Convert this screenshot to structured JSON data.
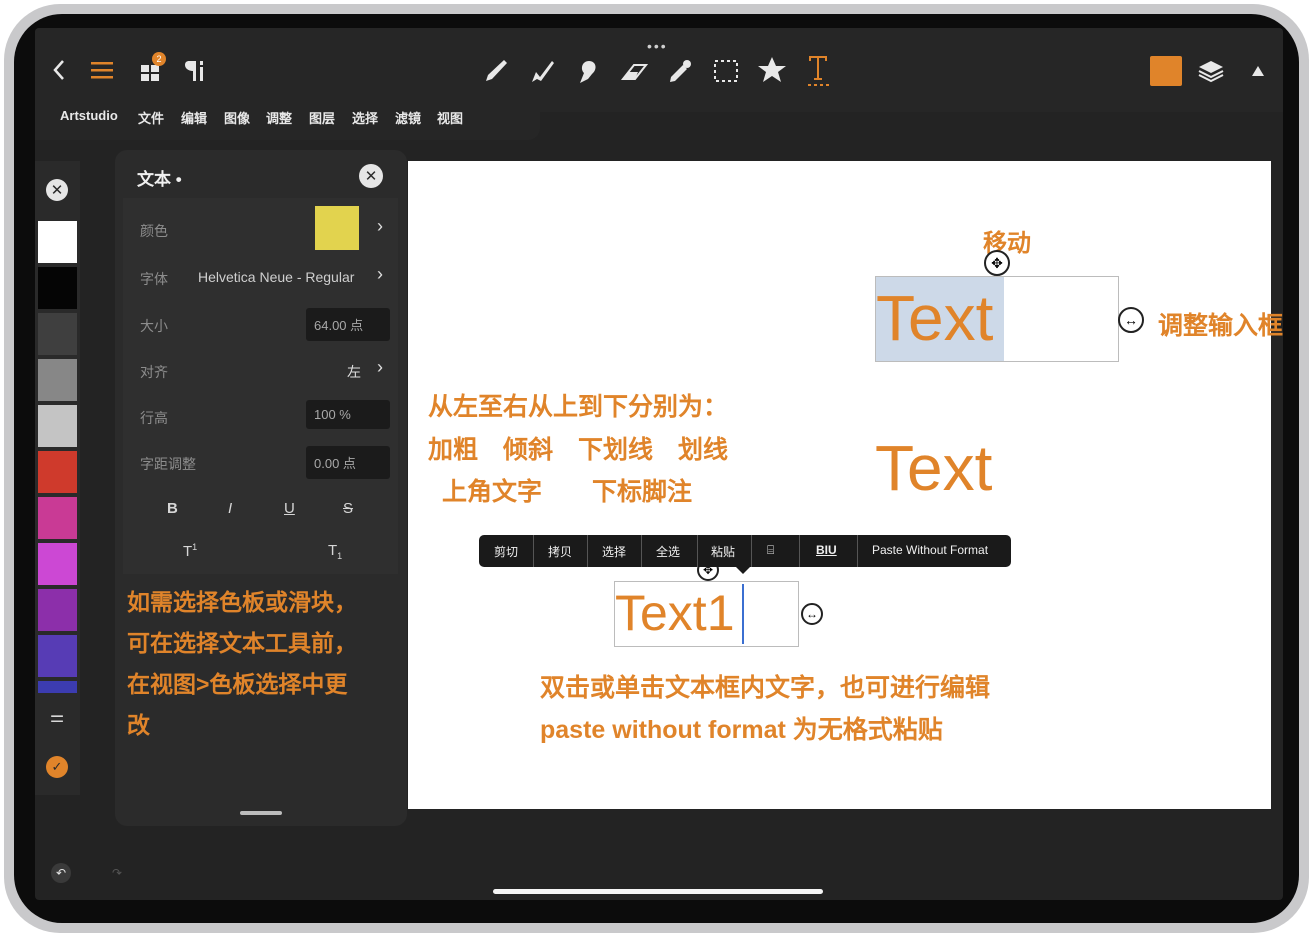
{
  "colors": {
    "accent": "#e0842a",
    "text_color_swatch": "#e2d34e",
    "selection": "#cdd9e8"
  },
  "toolbar": {
    "back_icon": "chevron-left-icon",
    "menu_icon": "hamburger-icon",
    "grid_badge": "2",
    "tools": [
      "brush-icon",
      "smudge-icon",
      "fill-icon",
      "eraser-icon",
      "eyedropper-icon",
      "selection-icon",
      "star-icon",
      "text-tool-icon"
    ]
  },
  "menu": [
    "Artstudio",
    "文件",
    "编辑",
    "图像",
    "调整",
    "图层",
    "选择",
    "滤镜",
    "视图"
  ],
  "panel": {
    "title": "文本 •",
    "color_label": "颜色",
    "font_label": "字体",
    "font_value": "Helvetica Neue - Regular",
    "size_label": "大小",
    "size_value": "64.00 点",
    "align_label": "对齐",
    "align_value": "左",
    "lineheight_label": "行高",
    "lineheight_value": "100 %",
    "spacing_label": "字距调整",
    "spacing_value": "0.00 点",
    "format_buttons": [
      "B",
      "I",
      "U",
      "S"
    ],
    "sup_label": "T",
    "sup_mark": "1",
    "sub_label": "T",
    "sub_mark": "1"
  },
  "swatches": [
    "#ffffff",
    "#050505",
    "#3f3f3f",
    "#878787",
    "#c4c4c4",
    "#cf3a2c",
    "#c93a95",
    "#cc48d4",
    "#8c2faa",
    "#573cb5",
    "#3c3cb0"
  ],
  "canvas": {
    "move_label": "移动",
    "resize_label": "调整输入框",
    "text1": "Text",
    "text2": "Text",
    "text3": "Text1",
    "annotation_formats_title": "从左至右从上到下分别为：",
    "annotation_formats_line1": "加粗　倾斜　下划线　划线",
    "annotation_formats_line2": "上角文字　　下标脚注",
    "annotation_palette_line1": "如需选择色板或滑块，",
    "annotation_palette_line2": "可在选择文本工具前，",
    "annotation_palette_line3": "在视图>色板选择中更",
    "annotation_palette_line4": "改",
    "annotation_edit_line1": "双击或单击文本框内文字，也可进行编辑",
    "annotation_edit_line2": "paste without format 为无格式粘贴"
  },
  "context_menu": [
    "剪切",
    "拷贝",
    "选择",
    "全选",
    "粘贴",
    "BIU",
    "Paste Without Format"
  ]
}
